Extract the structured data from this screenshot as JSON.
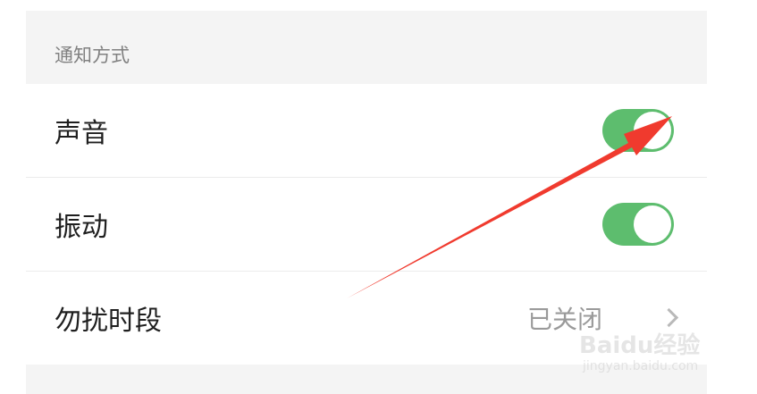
{
  "section": {
    "title": "通知方式"
  },
  "settings": [
    {
      "label": "声音",
      "type": "toggle",
      "on": true
    },
    {
      "label": "振动",
      "type": "toggle",
      "on": true
    },
    {
      "label": "勿扰时段",
      "type": "link",
      "value": "已关闭"
    }
  ],
  "watermark": {
    "logo": "Baidu经验",
    "url": "jingyan.baidu.com"
  },
  "colors": {
    "toggle_on": "#5dbd6e",
    "annotation_arrow": "#f03a2e",
    "background": "#f4f4f4"
  },
  "icons": {
    "chevron": "chevron-right-icon",
    "arrow": "red-annotation-arrow"
  }
}
